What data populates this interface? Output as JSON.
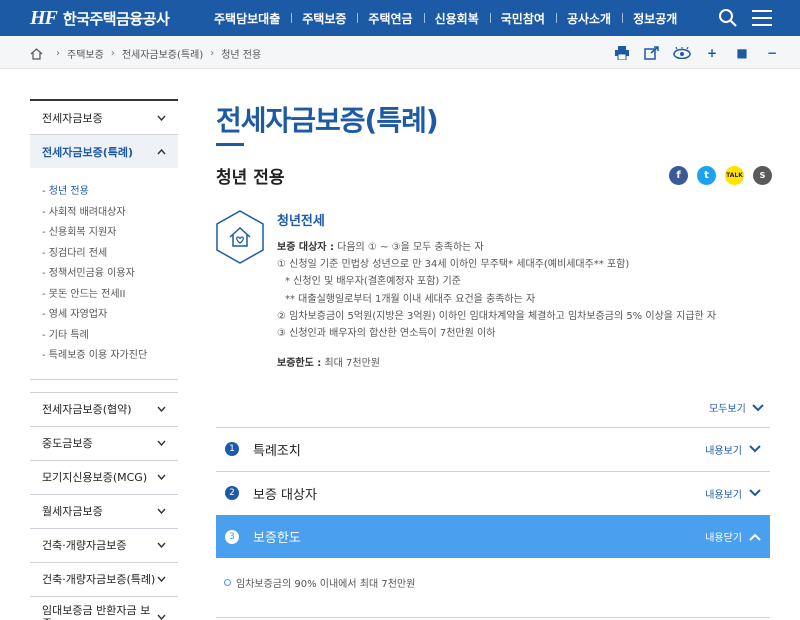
{
  "header": {
    "logo_mark": "HF",
    "logo_text": "한국주택금융공사",
    "nav": [
      "주택담보대출",
      "주택보증",
      "주택연금",
      "신용회복",
      "국민참여",
      "공사소개",
      "정보공개"
    ]
  },
  "breadcrumb": [
    "주택보증",
    "전세자금보증(특례)",
    "청년 전용"
  ],
  "lnb": {
    "groups_top": [
      {
        "label": "전세자금보증",
        "active": false
      },
      {
        "label": "전세자금보증(특례)",
        "active": true
      }
    ],
    "sub_items": [
      "청년 전용",
      "사회적 배려대상자",
      "신용회복 지원자",
      "징검다리 전세",
      "정책서민금융 이용자",
      "못돈 안드는 전세II",
      "영세 자영업자",
      "기타 특례",
      "특례보증 이용 자가진단"
    ],
    "groups_bottom": [
      "전세자금보증(협약)",
      "중도금보증",
      "모기지신용보증(MCG)",
      "월세자금보증",
      "건축·개량자금보증",
      "건축·개량자금보증(특례)",
      "임대보증금 반환자금 보증"
    ]
  },
  "content": {
    "page_title": "전세자금보증(특례)",
    "sub_title": "청년 전용",
    "share": {
      "facebook": "f",
      "twitter": "t",
      "kakao": "TALK",
      "kakaostory": "S"
    },
    "product_title": "청년전세",
    "target_label": "보증 대상자 :",
    "target_text": "다음의 ① ~ ③을 모두 충족하는 자",
    "lines": [
      "① 신청일 기준 민법상 성년으로 만 34세 이하인 무주택* 세대주(예비세대주** 포함)",
      "* 신청인 및 배우자(결혼예정자 포함) 기준",
      "** 대출실행일로부터 1개월 이내 세대주 요건을 충족하는 자",
      "② 임차보증금이 5억원(지방은 3억원) 이하인 임대차계약을 체결하고 임차보증금의 5% 이상을 지급한 자",
      "③ 신청인과 배우자의 합산한 연소득이 7천만원 이하"
    ],
    "limit_label": "보증한도 :",
    "limit_text": "최대 7천만원",
    "expand_all": "모두보기",
    "accordion": [
      {
        "num": "1",
        "label": "특례조치",
        "toggle": "내용보기"
      },
      {
        "num": "2",
        "label": "보증 대상자",
        "toggle": "내용보기"
      },
      {
        "num": "3",
        "label": "보증한도",
        "toggle": "내용닫기"
      }
    ],
    "acc_body": "임차보증금의 90% 이내에서 최대 7천만원"
  },
  "colors": {
    "brand": "#1d5aa6",
    "accent": "#4a9fee",
    "facebook": "#3b5998",
    "twitter": "#1da1f2",
    "kakao": "#fee500",
    "kakaostory": "#5a5a5a"
  }
}
